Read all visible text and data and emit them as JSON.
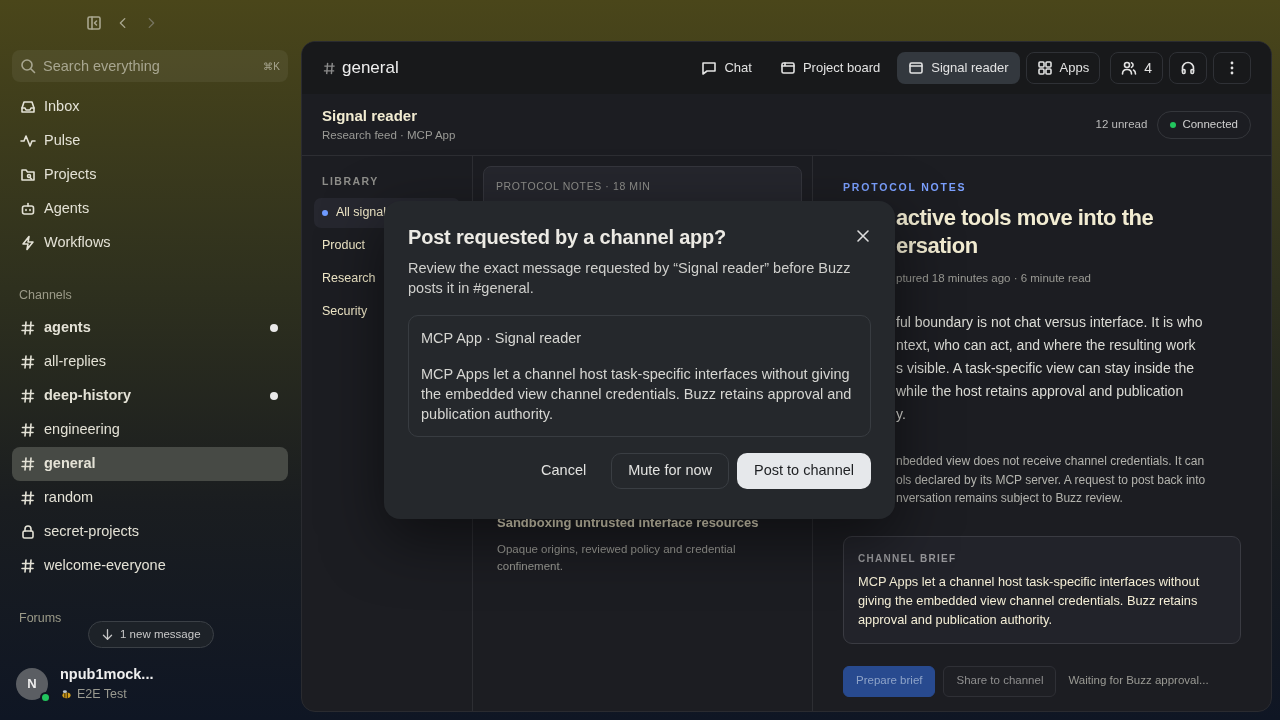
{
  "search": {
    "placeholder": "Search everything",
    "shortcut": "⌘K"
  },
  "nav": [
    {
      "label": "Inbox"
    },
    {
      "label": "Pulse"
    },
    {
      "label": "Projects"
    },
    {
      "label": "Agents"
    },
    {
      "label": "Workflows"
    }
  ],
  "channels_heading": "Channels",
  "channels": [
    {
      "name": "agents",
      "kind": "public",
      "unread": true,
      "selected": false
    },
    {
      "name": "all-replies",
      "kind": "public",
      "unread": false,
      "selected": false
    },
    {
      "name": "deep-history",
      "kind": "public",
      "unread": true,
      "selected": false
    },
    {
      "name": "engineering",
      "kind": "public",
      "unread": false,
      "selected": false
    },
    {
      "name": "general",
      "kind": "public",
      "unread": false,
      "selected": true
    },
    {
      "name": "random",
      "kind": "public",
      "unread": false,
      "selected": false
    },
    {
      "name": "secret-projects",
      "kind": "private",
      "unread": false,
      "selected": false
    },
    {
      "name": "welcome-everyone",
      "kind": "public",
      "unread": false,
      "selected": false
    }
  ],
  "forums_heading": "Forums",
  "new_message": "1 new message",
  "user": {
    "initial": "N",
    "name": "npub1mock...",
    "status": "E2E Test",
    "online": true
  },
  "channel_header": {
    "name": "general",
    "members": "4",
    "tabs": [
      {
        "label": "Chat",
        "selected": false
      },
      {
        "label": "Project board",
        "selected": false
      },
      {
        "label": "Signal reader",
        "selected": true
      },
      {
        "label": "Apps",
        "selected": false
      }
    ]
  },
  "app": {
    "title": "Signal reader",
    "subtitle": "Research feed · MCP App",
    "unread": "12 unread",
    "connection": "Connected",
    "connected": true
  },
  "library": {
    "heading": "LIBRARY",
    "items": [
      {
        "label": "All signal",
        "selected": true
      },
      {
        "label": "Product",
        "selected": false
      },
      {
        "label": "Research",
        "selected": false
      },
      {
        "label": "Security",
        "selected": false
      }
    ]
  },
  "feed": [
    {
      "meta": "PROTOCOL NOTES · 18 MIN"
    },
    {
      "title": "Sandboxing untrusted interface resources",
      "summary": "Opaque origins, reviewed policy and credential confinement."
    }
  ],
  "article": {
    "category": "PROTOCOL NOTES",
    "title_lines": [
      "active tools move into the",
      "ersation"
    ],
    "meta": "ptured 18 minutes ago · 6 minute read",
    "body_lines": [
      "ful boundary is not chat versus interface. It is who",
      "ntext, who can act, and where the resulting work",
      "s visible. A task-specific view can stay inside the",
      "while the host retains approval and publication",
      "y."
    ],
    "note_lines": [
      "nbedded view does not receive channel credentials. It can",
      "ols declared by its MCP server. A request to post back into",
      "nversation remains subject to Buzz review."
    ],
    "brief": {
      "heading": "CHANNEL BRIEF",
      "text": "MCP Apps let a channel host task-specific interfaces without giving the embedded view channel credentials. Buzz retains approval and publication authority."
    },
    "actions": [
      "Prepare brief",
      "Share to channel"
    ],
    "waiting": "Waiting for Buzz approval..."
  },
  "dialog": {
    "title": "Post requested by a channel app?",
    "description": "Review the exact message requested by “Signal reader” before Buzz posts it in #general.",
    "preview_source": "MCP App · Signal reader",
    "preview_text": "MCP Apps let a channel host task-specific interfaces without giving the embedded view channel credentials. Buzz retains approval and publication authority.",
    "buttons": [
      {
        "label": "Cancel",
        "kind": "plain"
      },
      {
        "label": "Mute for now",
        "kind": "outline"
      },
      {
        "label": "Post to channel",
        "kind": "primary"
      }
    ]
  }
}
